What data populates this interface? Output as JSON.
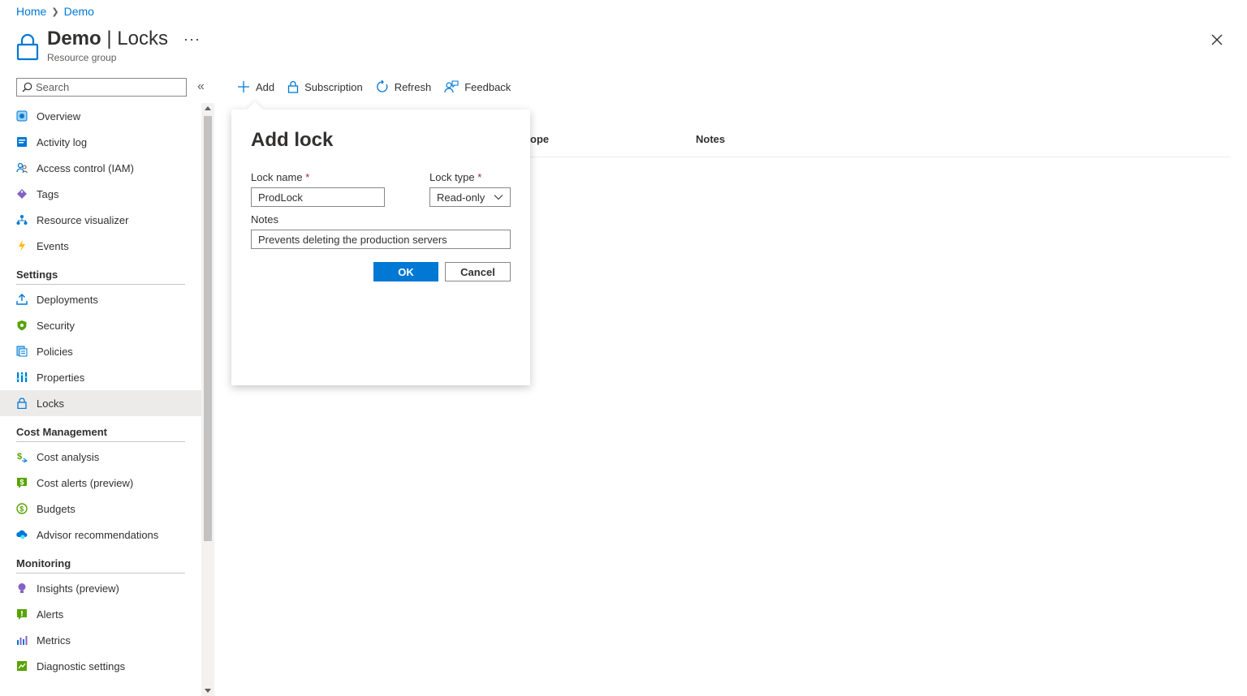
{
  "breadcrumb": {
    "home": "Home",
    "current": "Demo"
  },
  "header": {
    "name": "Demo",
    "separator": " | ",
    "page": "Locks",
    "subtitle": "Resource group",
    "more": "···"
  },
  "search": {
    "placeholder": "Search"
  },
  "nav": {
    "top": [
      "Overview",
      "Activity log",
      "Access control (IAM)",
      "Tags",
      "Resource visualizer",
      "Events"
    ],
    "settings_title": "Settings",
    "settings": [
      "Deployments",
      "Security",
      "Policies",
      "Properties",
      "Locks"
    ],
    "cost_title": "Cost Management",
    "cost": [
      "Cost analysis",
      "Cost alerts (preview)",
      "Budgets",
      "Advisor recommendations"
    ],
    "monitoring_title": "Monitoring",
    "monitoring": [
      "Insights (preview)",
      "Alerts",
      "Metrics",
      "Diagnostic settings"
    ]
  },
  "toolbar": {
    "add": "Add",
    "subscription": "Subscription",
    "refresh": "Refresh",
    "feedback": "Feedback"
  },
  "table": {
    "col_scope_partial": "ope",
    "col_notes": "Notes"
  },
  "dialog": {
    "title": "Add lock",
    "lock_name_label": "Lock name",
    "lock_name_value": "ProdLock",
    "lock_type_label": "Lock type",
    "lock_type_value": "Read-only",
    "required_mark": "*",
    "notes_label": "Notes",
    "notes_value": "Prevents deleting the production servers",
    "ok": "OK",
    "cancel": "Cancel"
  },
  "colors": {
    "accent": "#0078d4",
    "active_bg": "#edebe9",
    "required": "#a4262c"
  }
}
